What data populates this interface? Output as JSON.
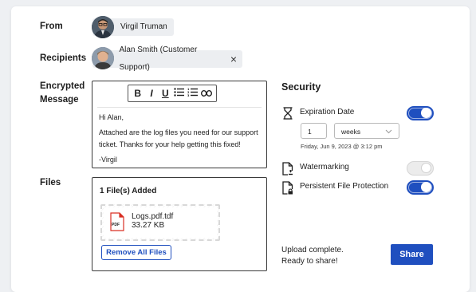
{
  "from": {
    "label": "From",
    "name": "Virgil Truman"
  },
  "recipients": {
    "label": "Recipients",
    "items": [
      {
        "name": "Alan Smith (Customer Support)",
        "remove": "×"
      }
    ]
  },
  "message": {
    "label_line1": "Encrypted",
    "label_line2": "Message",
    "toolbar": {
      "bold": "B",
      "italic": "I",
      "underline": "U"
    },
    "greeting": "Hi Alan,",
    "body": "Attached are the log files you need for our support ticket. Thanks for your help getting this fixed!",
    "signature": "-Virgil"
  },
  "files": {
    "label": "Files",
    "count_text": "1 File(s) Added",
    "items": [
      {
        "type_badge": "PDF",
        "name": "Logs.pdf.tdf",
        "size": "33.27 KB"
      }
    ],
    "remove_all": "Remove All Files"
  },
  "security": {
    "title": "Security",
    "expiration": {
      "label": "Expiration Date",
      "enabled": true,
      "amount": "1",
      "unit": "weeks",
      "date_text": "Friday, Jun 9, 2023 @ 3:12 pm"
    },
    "watermarking": {
      "label": "Watermarking",
      "enabled": false
    },
    "persistent": {
      "label": "Persistent File Protection",
      "enabled": true
    }
  },
  "status": {
    "line1": "Upload complete.",
    "line2": "Ready to share!"
  },
  "share_button": "Share",
  "colors": {
    "accent": "#1f4fbf",
    "pdf_red": "#d93025"
  }
}
